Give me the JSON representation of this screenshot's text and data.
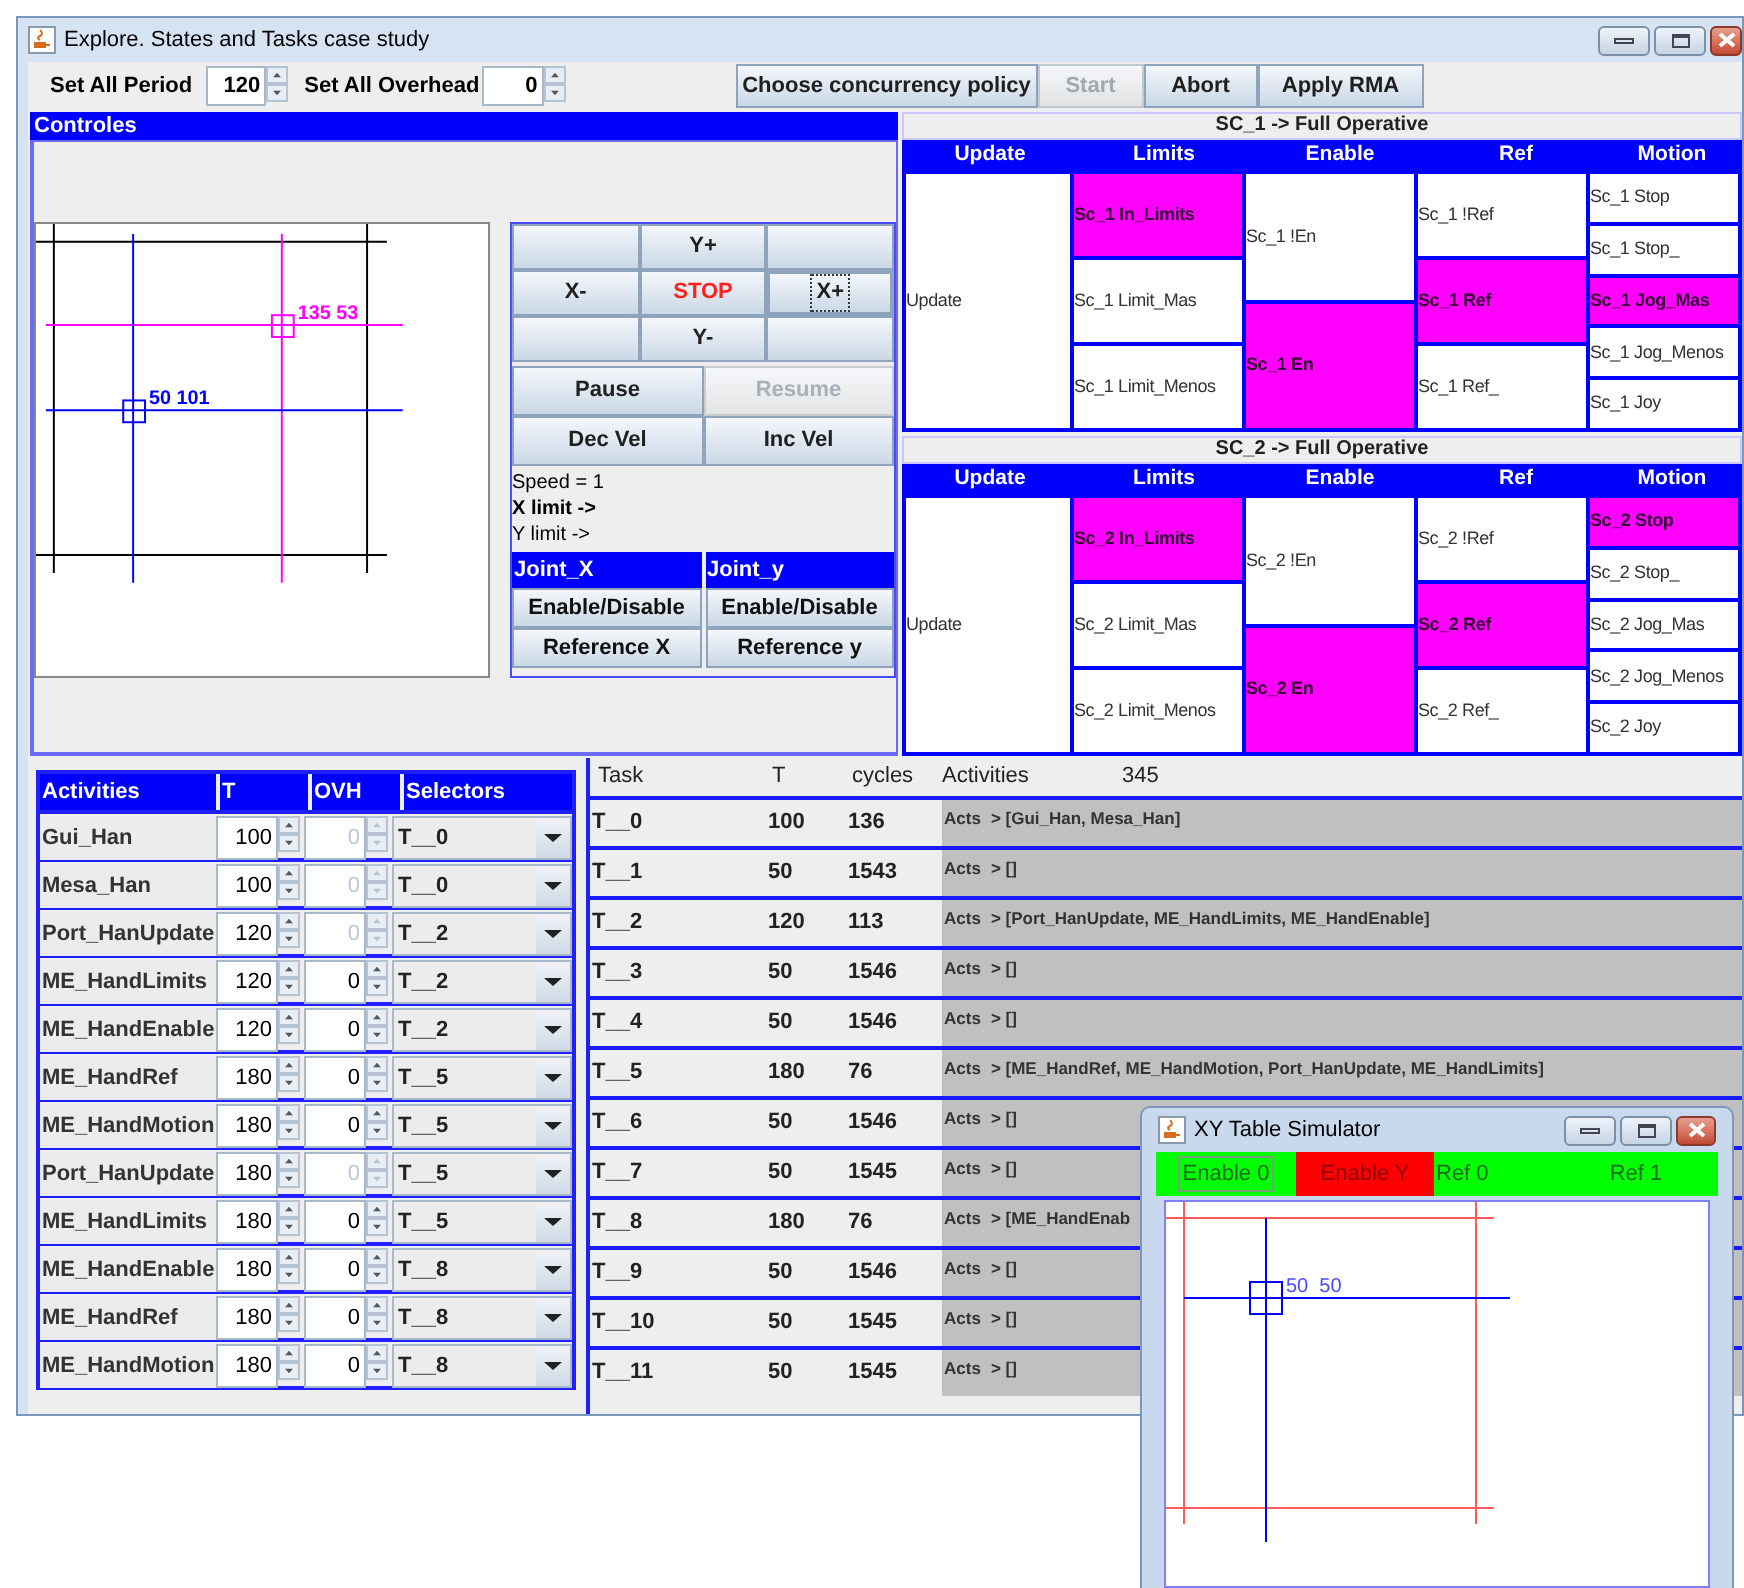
{
  "window": {
    "title": "Explore. States and Tasks case study"
  },
  "toolbar": {
    "fields": [
      {
        "label": "Set All Period",
        "value": "120"
      },
      {
        "label": "Set All Overhead",
        "value": "0"
      }
    ],
    "buttons": [
      {
        "label": "Choose concurrency policy",
        "disabled": false
      },
      {
        "label": "Start",
        "disabled": true
      },
      {
        "label": "Abort",
        "disabled": false
      },
      {
        "label": "Apply RMA",
        "disabled": false
      }
    ]
  },
  "controls": {
    "title": "Controles",
    "plot_labels": [
      {
        "text": "135 53",
        "kind": "target"
      },
      {
        "text": "50 101",
        "kind": "position"
      }
    ],
    "jog": [
      {
        "label": "Y+",
        "kind": "move",
        "focused": false
      },
      {
        "label": "X-",
        "kind": "move",
        "focused": false
      },
      {
        "label": "STOP",
        "kind": "stop",
        "focused": false
      },
      {
        "label": "X+",
        "kind": "move",
        "focused": true
      },
      {
        "label": "Y-",
        "kind": "move",
        "focused": false
      }
    ],
    "pause_buttons": [
      {
        "label": "Pause",
        "disabled": false
      },
      {
        "label": "Resume",
        "disabled": true
      }
    ],
    "speed_buttons": [
      "Dec Vel",
      "Inc Vel"
    ],
    "status_lines": [
      "Speed = 1",
      "X limit ->",
      "Y limit ->"
    ],
    "joints": [
      {
        "name": "Joint_X",
        "enable": "Enable/Disable",
        "reference": "Reference X"
      },
      {
        "name": "Joint_y",
        "enable": "Enable/Disable",
        "reference": "Reference y"
      }
    ]
  },
  "state_charts": [
    {
      "title": "SC_1 -> Full Operative",
      "columns": [
        {
          "header": "Update",
          "states": [
            {
              "label": "Update",
              "active": false
            }
          ]
        },
        {
          "header": "Limits",
          "states": [
            {
              "label": "Sc_1 In_Limits",
              "active": true
            },
            {
              "label": "Sc_1 Limit_Mas",
              "active": false
            },
            {
              "label": "Sc_1 Limit_Menos",
              "active": false
            }
          ]
        },
        {
          "header": "Enable",
          "states": [
            {
              "label": "Sc_1 !En",
              "active": false
            },
            {
              "label": "Sc_1 En",
              "active": true
            }
          ]
        },
        {
          "header": "Ref",
          "states": [
            {
              "label": "Sc_1 !Ref",
              "active": false
            },
            {
              "label": "Sc_1 Ref",
              "active": true
            },
            {
              "label": "Sc_1 Ref_",
              "active": false
            }
          ]
        },
        {
          "header": "Motion",
          "states": [
            {
              "label": "Sc_1 Stop",
              "active": false
            },
            {
              "label": "Sc_1 Stop_",
              "active": false
            },
            {
              "label": "Sc_1 Jog_Mas",
              "active": true
            },
            {
              "label": "Sc_1 Jog_Menos",
              "active": false
            },
            {
              "label": "Sc_1 Joy",
              "active": false
            }
          ]
        }
      ]
    },
    {
      "title": "SC_2 -> Full Operative",
      "columns": [
        {
          "header": "Update",
          "states": [
            {
              "label": "Update",
              "active": false
            }
          ]
        },
        {
          "header": "Limits",
          "states": [
            {
              "label": "Sc_2 In_Limits",
              "active": true
            },
            {
              "label": "Sc_2 Limit_Mas",
              "active": false
            },
            {
              "label": "Sc_2 Limit_Menos",
              "active": false
            }
          ]
        },
        {
          "header": "Enable",
          "states": [
            {
              "label": "Sc_2 !En",
              "active": false
            },
            {
              "label": "Sc_2 En",
              "active": true
            }
          ]
        },
        {
          "header": "Ref",
          "states": [
            {
              "label": "Sc_2 !Ref",
              "active": false
            },
            {
              "label": "Sc_2 Ref",
              "active": true
            },
            {
              "label": "Sc_2 Ref_",
              "active": false
            }
          ]
        },
        {
          "header": "Motion",
          "states": [
            {
              "label": "Sc_2 Stop",
              "active": true
            },
            {
              "label": "Sc_2 Stop_",
              "active": false
            },
            {
              "label": "Sc_2 Jog_Mas",
              "active": false
            },
            {
              "label": "Sc_2 Jog_Menos",
              "active": false
            },
            {
              "label": "Sc_2 Joy",
              "active": false
            }
          ]
        }
      ]
    }
  ],
  "activities": {
    "columns": [
      "Activities",
      "T",
      "OVH",
      "Selectors"
    ],
    "rows": [
      {
        "name": "Gui_Han",
        "t": "100",
        "ovh": "0",
        "ovh_disabled": true,
        "selector": "T__0"
      },
      {
        "name": "Mesa_Han",
        "t": "100",
        "ovh": "0",
        "ovh_disabled": true,
        "selector": "T__0"
      },
      {
        "name": "Port_HanUpdate",
        "t": "120",
        "ovh": "0",
        "ovh_disabled": true,
        "selector": "T__2"
      },
      {
        "name": "ME_HandLimits",
        "t": "120",
        "ovh": "0",
        "ovh_disabled": false,
        "selector": "T__2"
      },
      {
        "name": "ME_HandEnable",
        "t": "120",
        "ovh": "0",
        "ovh_disabled": false,
        "selector": "T__2"
      },
      {
        "name": "ME_HandRef",
        "t": "180",
        "ovh": "0",
        "ovh_disabled": false,
        "selector": "T__5"
      },
      {
        "name": "ME_HandMotion",
        "t": "180",
        "ovh": "0",
        "ovh_disabled": false,
        "selector": "T__5"
      },
      {
        "name": "Port_HanUpdate",
        "t": "180",
        "ovh": "0",
        "ovh_disabled": true,
        "selector": "T__5"
      },
      {
        "name": "ME_HandLimits",
        "t": "180",
        "ovh": "0",
        "ovh_disabled": false,
        "selector": "T__5"
      },
      {
        "name": "ME_HandEnable",
        "t": "180",
        "ovh": "0",
        "ovh_disabled": false,
        "selector": "T__8"
      },
      {
        "name": "ME_HandRef",
        "t": "180",
        "ovh": "0",
        "ovh_disabled": false,
        "selector": "T__8"
      },
      {
        "name": "ME_HandMotion",
        "t": "180",
        "ovh": "0",
        "ovh_disabled": false,
        "selector": "T__8"
      }
    ]
  },
  "tasks": {
    "columns": [
      "Task",
      "T",
      "cycles",
      "Activities"
    ],
    "total": "345",
    "rows": [
      {
        "task": "T__0",
        "t": "100",
        "cycles": "136",
        "acts_label": "Acts",
        "acts": "> [Gui_Han, Mesa_Han]"
      },
      {
        "task": "T__1",
        "t": "50",
        "cycles": "1543",
        "acts_label": "Acts",
        "acts": "> []"
      },
      {
        "task": "T__2",
        "t": "120",
        "cycles": "113",
        "acts_label": "Acts",
        "acts": "> [Port_HanUpdate, ME_HandLimits, ME_HandEnable]"
      },
      {
        "task": "T__3",
        "t": "50",
        "cycles": "1546",
        "acts_label": "Acts",
        "acts": "> []"
      },
      {
        "task": "T__4",
        "t": "50",
        "cycles": "1546",
        "acts_label": "Acts",
        "acts": "> []"
      },
      {
        "task": "T__5",
        "t": "180",
        "cycles": "76",
        "acts_label": "Acts",
        "acts": "> [ME_HandRef, ME_HandMotion, Port_HanUpdate, ME_HandLimits]"
      },
      {
        "task": "T__6",
        "t": "50",
        "cycles": "1546",
        "acts_label": "Acts",
        "acts": "> []"
      },
      {
        "task": "T__7",
        "t": "50",
        "cycles": "1545",
        "acts_label": "Acts",
        "acts": "> []"
      },
      {
        "task": "T__8",
        "t": "180",
        "cycles": "76",
        "acts_label": "Acts",
        "acts": "> [ME_HandEnab"
      },
      {
        "task": "T__9",
        "t": "50",
        "cycles": "1546",
        "acts_label": "Acts",
        "acts": "> []"
      },
      {
        "task": "T__10",
        "t": "50",
        "cycles": "1545",
        "acts_label": "Acts",
        "acts": "> []"
      },
      {
        "task": "T__11",
        "t": "50",
        "cycles": "1545",
        "acts_label": "Acts",
        "acts": "> []"
      }
    ]
  },
  "simulator": {
    "title": "XY Table Simulator",
    "indicators": [
      {
        "label": "Enable 0",
        "on": true,
        "focused": true
      },
      {
        "label": "Enable Y",
        "on": false,
        "focused": false
      },
      {
        "label": "Ref 0",
        "on": true,
        "focused": false
      },
      {
        "label": "Ref 1",
        "on": true,
        "focused": false
      }
    ],
    "plot_label": "50  50"
  }
}
